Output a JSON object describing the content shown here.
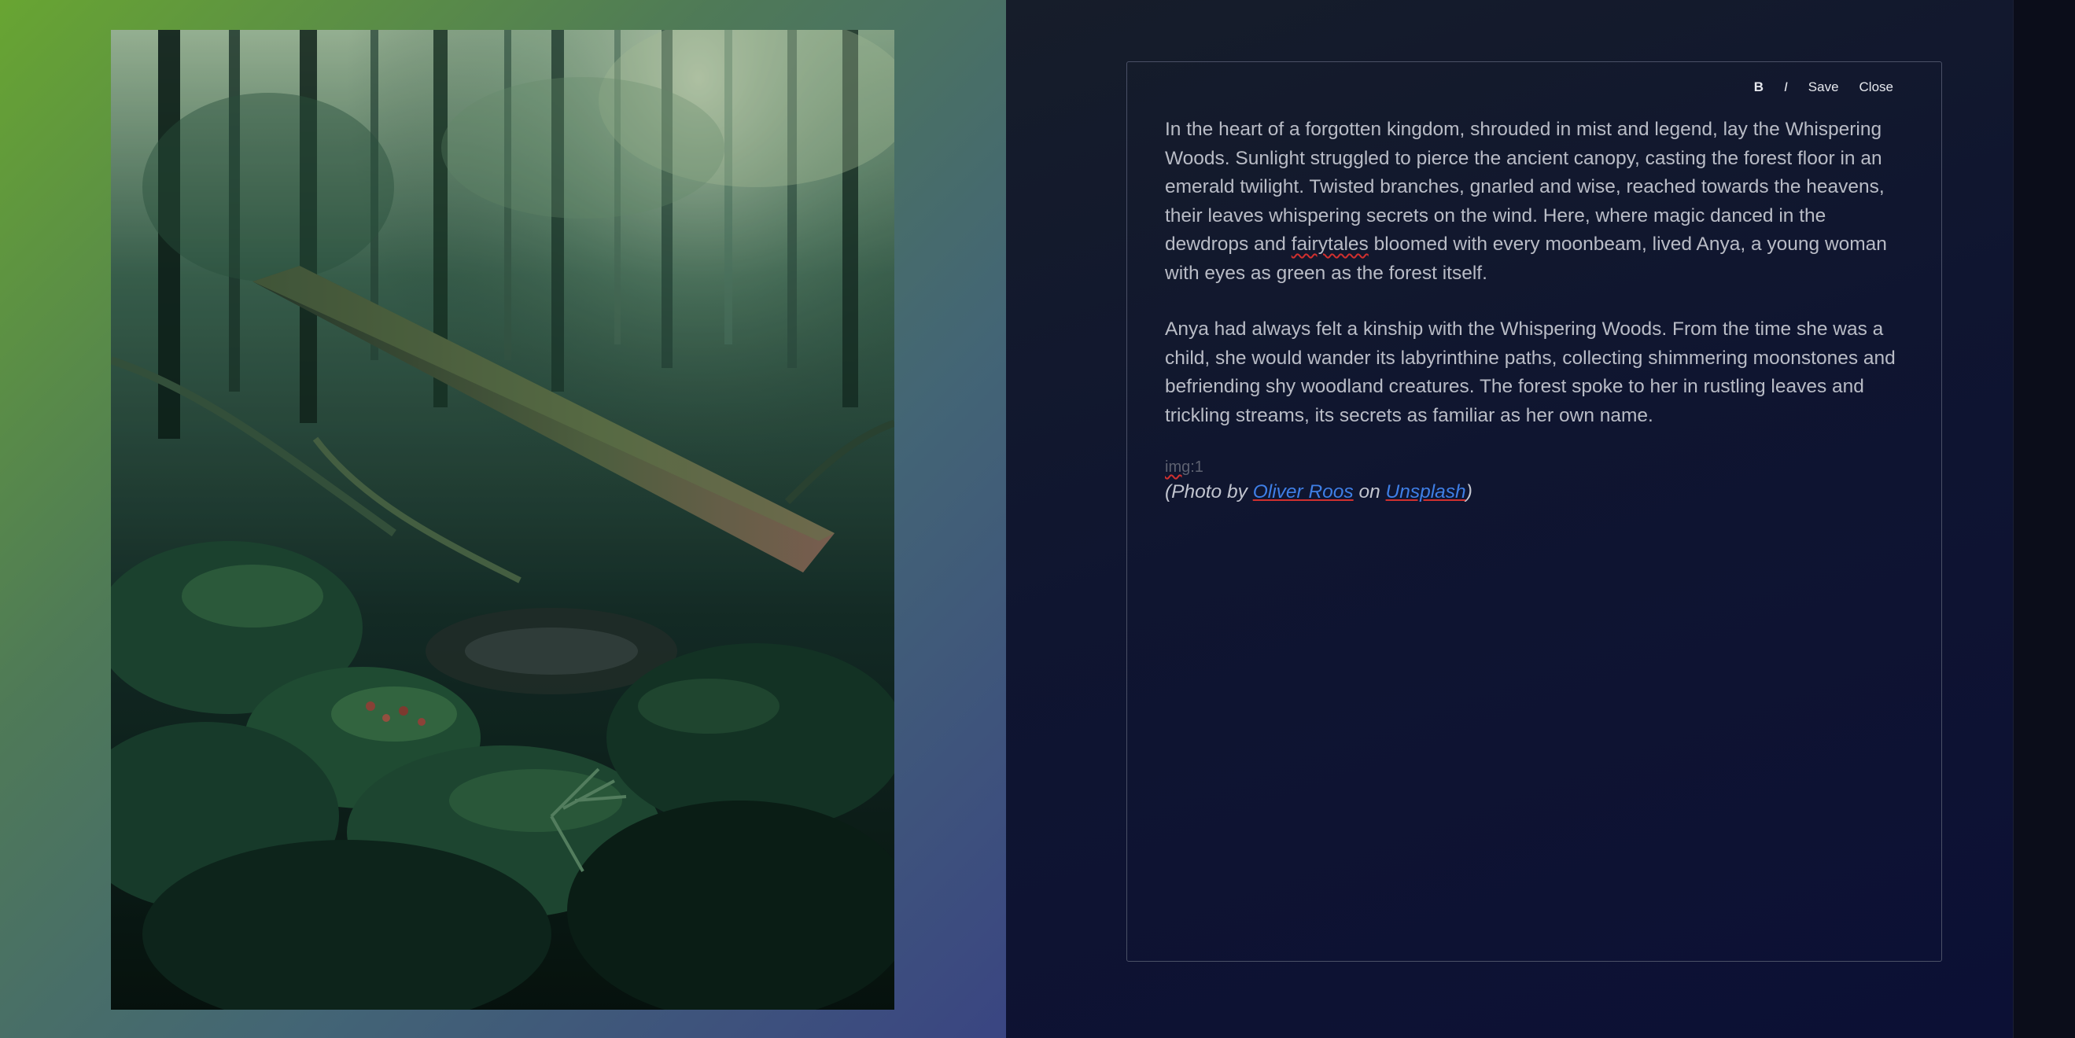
{
  "toolbar": {
    "bold_label": "B",
    "italic_label": "I",
    "save_label": "Save",
    "close_label": "Close"
  },
  "story": {
    "p1_a": "In the heart of a forgotten kingdom, shrouded in mist and legend, lay the Whispering Woods. Sunlight struggled to pierce the ancient canopy, casting the forest floor in an emerald twilight. Twisted branches, gnarled and wise, reached towards the heavens, their leaves whispering secrets on the wind. Here, where magic danced in the dewdrops and ",
    "p1_misspelled": "fairytales",
    "p1_b": " bloomed with every moonbeam, lived Anya, a young woman with eyes as green as the forest itself.",
    "p2": "Anya had always felt a kinship with the Whispering Woods. From the time she was a child, she would wander its labyrinthine paths, collecting shimmering moonstones and befriending shy woodland creatures. The forest spoke to her in rustling leaves and trickling streams, its secrets as familiar as her own name."
  },
  "image_ref": {
    "prefix": "img",
    "suffix": ":1"
  },
  "credit": {
    "open": "(Photo by ",
    "author": "Oliver Roos",
    "middle": " on ",
    "site": "Unsplash",
    "close": ")"
  },
  "colors": {
    "link": "#3f7fe6",
    "spellcheck": "#d0302f",
    "gradient_start": "#68a532",
    "gradient_end": "#3a4582"
  },
  "icons": {
    "forest_photo": "forest-photo"
  }
}
